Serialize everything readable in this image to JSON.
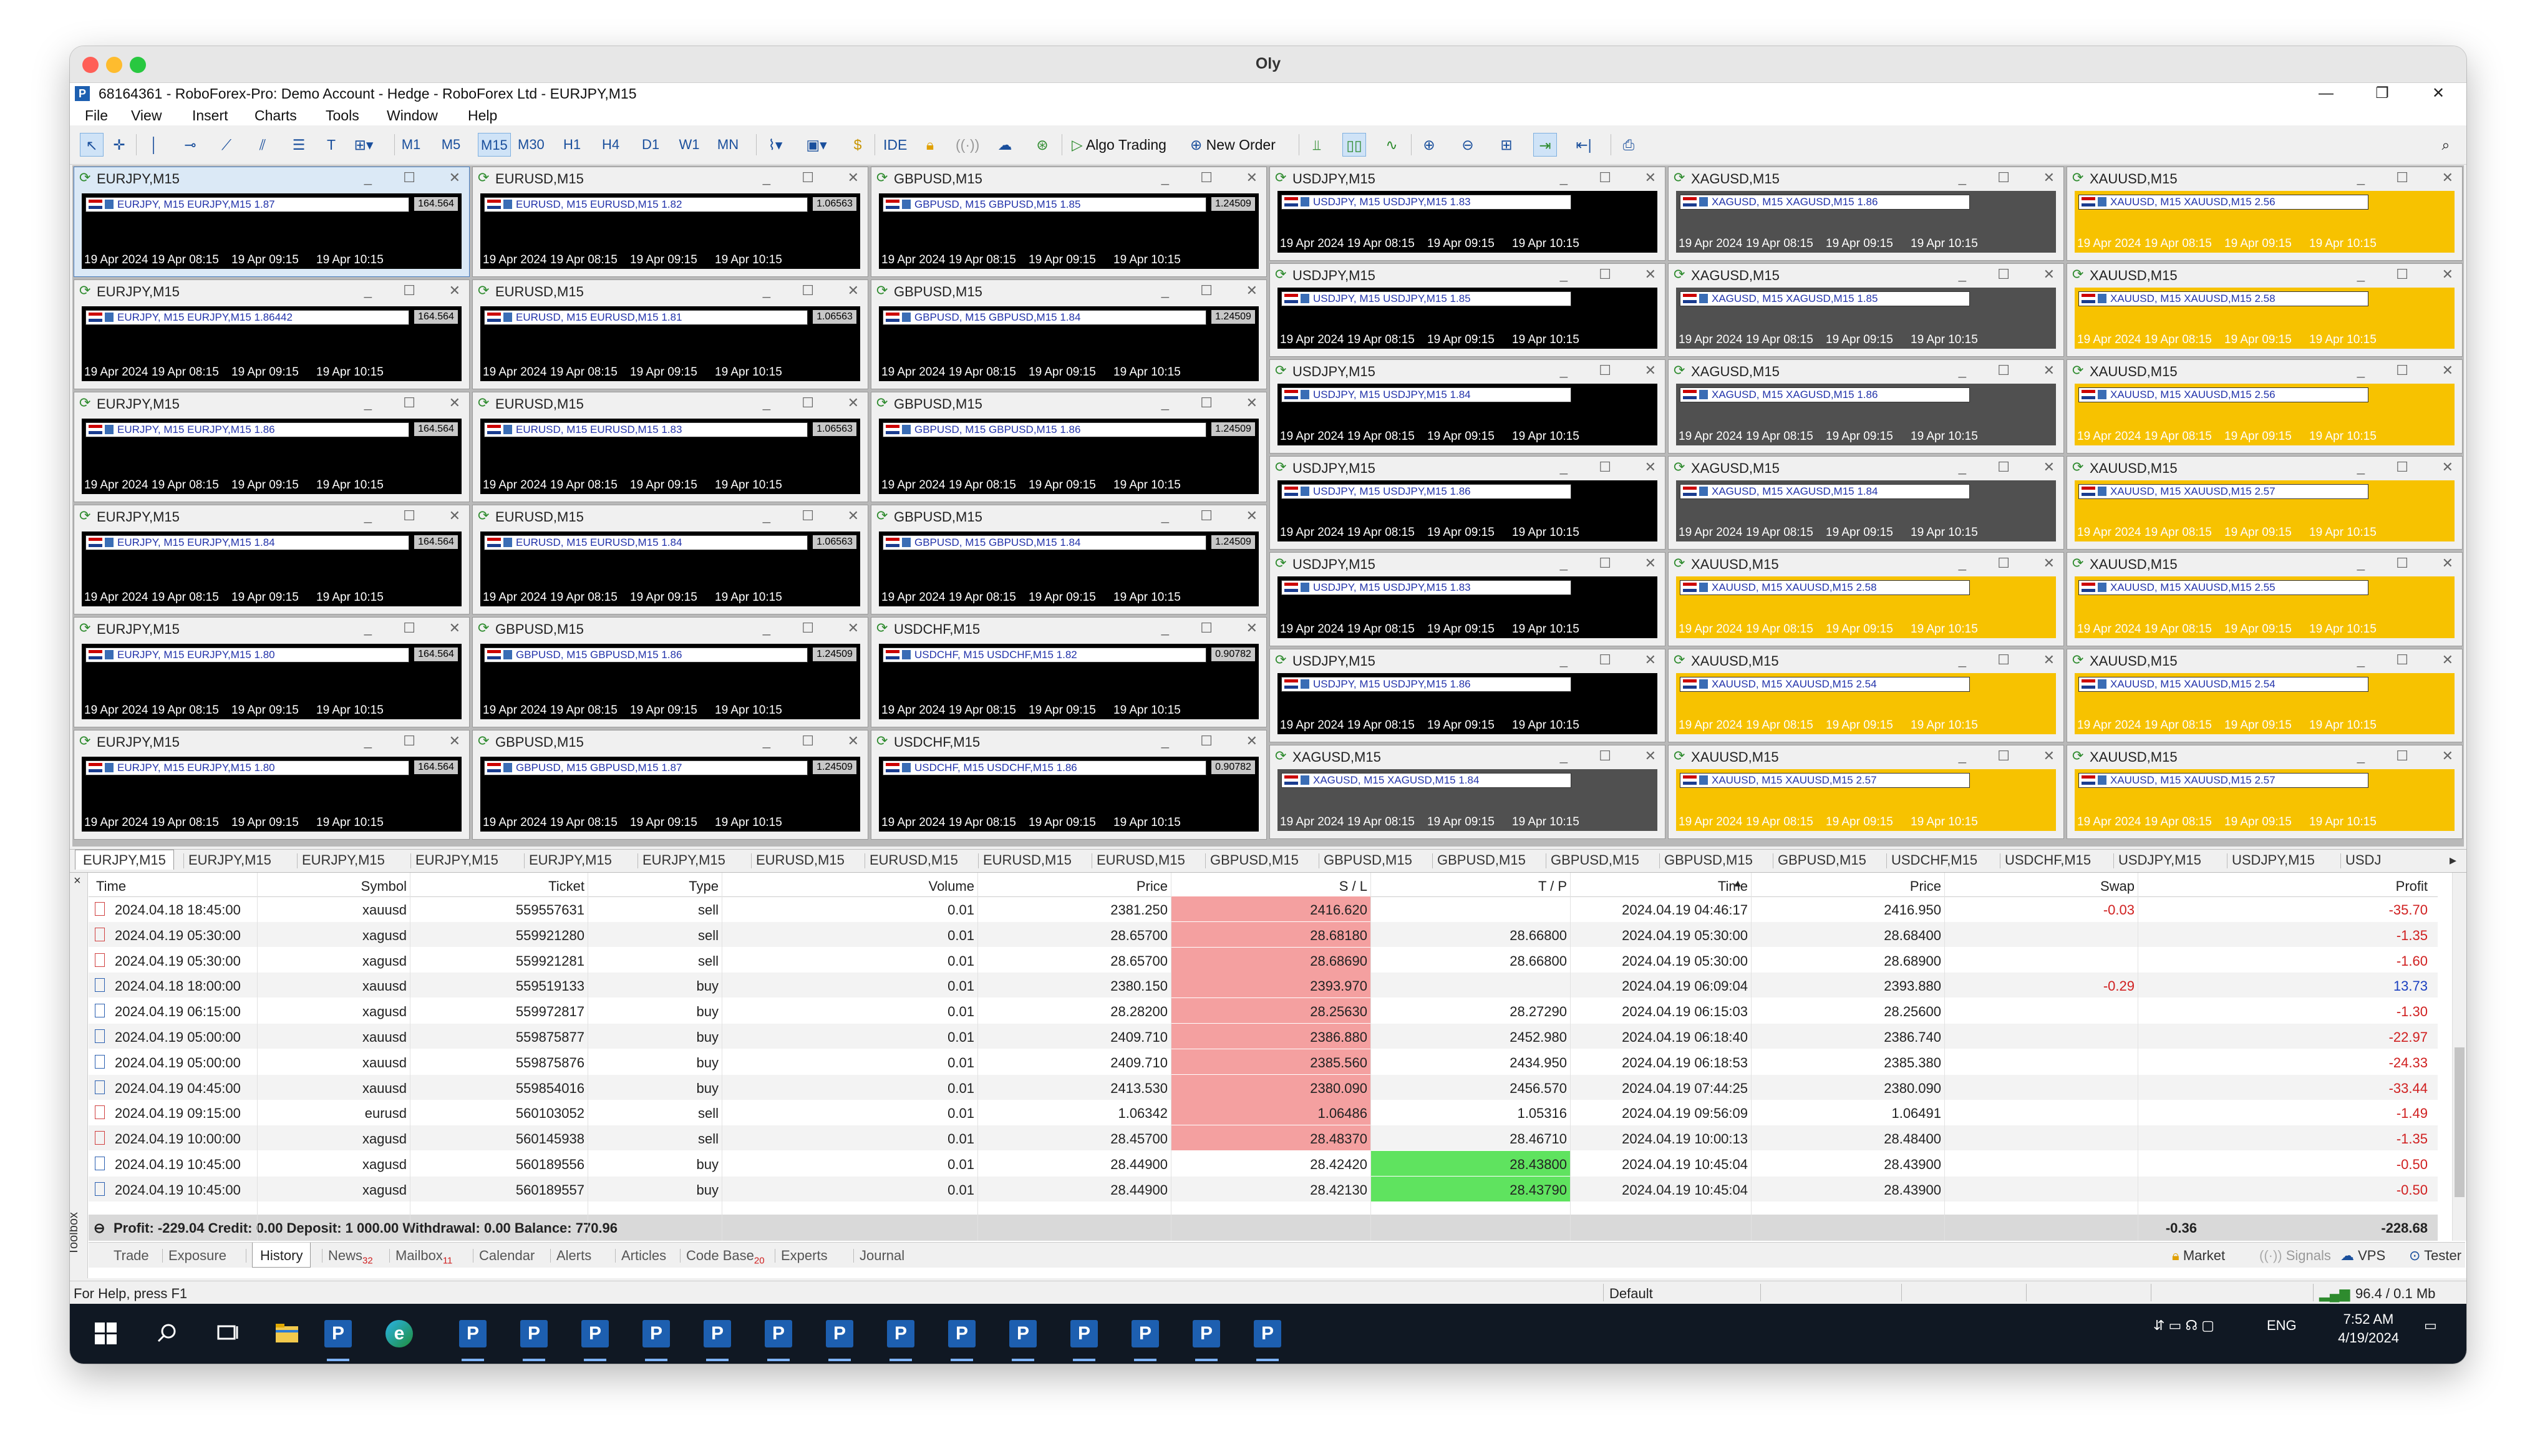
{
  "mac_window": {
    "title": "Oly"
  },
  "app": {
    "title": "68164361 - RoboForex-Pro: Demo Account - Hedge - RoboForex Ltd - EURJPY,M15",
    "app_icon": "mt5-icon",
    "window_controls": {
      "minimize": "—",
      "restore": "❐",
      "close": "✕"
    }
  },
  "menu": [
    "File",
    "View",
    "Insert",
    "Charts",
    "Tools",
    "Window",
    "Help"
  ],
  "toolbar": {
    "timeframes": [
      "M1",
      "M5",
      "M15",
      "M30",
      "H1",
      "H4",
      "D1",
      "W1",
      "MN"
    ],
    "active_timeframe": "M15",
    "ide_label": "IDE",
    "algo_trading_label": "Algo Trading",
    "new_order_label": "New Order"
  },
  "chart_axis_times": [
    "19 Apr 2024",
    "19 Apr 08:15",
    "19 Apr 09:15",
    "19 Apr 10:15"
  ],
  "charts": [
    {
      "symbol": "EURJPY,M15",
      "col": 0,
      "row": 0,
      "bg": "black",
      "strip": "EURJPY, M15 EURJPY,M15 1.87",
      "price": "164.564",
      "active": true
    },
    {
      "symbol": "EURJPY,M15",
      "col": 0,
      "row": 1,
      "bg": "black",
      "strip": "EURJPY, M15 EURJPY,M15 1.86442",
      "price": "164.564"
    },
    {
      "symbol": "EURJPY,M15",
      "col": 0,
      "row": 2,
      "bg": "black",
      "strip": "EURJPY, M15 EURJPY,M15 1.86",
      "price": "164.564"
    },
    {
      "symbol": "EURJPY,M15",
      "col": 0,
      "row": 3,
      "bg": "black",
      "strip": "EURJPY, M15 EURJPY,M15 1.84",
      "price": "164.564"
    },
    {
      "symbol": "EURJPY,M15",
      "col": 0,
      "row": 4,
      "bg": "black",
      "strip": "EURJPY, M15 EURJPY,M15 1.80",
      "price": "164.564"
    },
    {
      "symbol": "EURJPY,M15",
      "col": 0,
      "row": 5,
      "bg": "black",
      "strip": "EURJPY, M15 EURJPY,M15 1.80",
      "price": "164.564"
    },
    {
      "symbol": "EURUSD,M15",
      "col": 1,
      "row": 0,
      "bg": "black",
      "strip": "EURUSD, M15 EURUSD,M15 1.82",
      "price": "1.06563"
    },
    {
      "symbol": "EURUSD,M15",
      "col": 1,
      "row": 1,
      "bg": "black",
      "strip": "EURUSD, M15 EURUSD,M15 1.81",
      "price": "1.06563"
    },
    {
      "symbol": "EURUSD,M15",
      "col": 1,
      "row": 2,
      "bg": "black",
      "strip": "EURUSD, M15 EURUSD,M15 1.83",
      "price": "1.06563"
    },
    {
      "symbol": "EURUSD,M15",
      "col": 1,
      "row": 3,
      "bg": "black",
      "strip": "EURUSD, M15 EURUSD,M15 1.84",
      "price": "1.06563"
    },
    {
      "symbol": "GBPUSD,M15",
      "col": 1,
      "row": 4,
      "bg": "black",
      "strip": "GBPUSD, M15 GBPUSD,M15 1.86",
      "price": "1.24509"
    },
    {
      "symbol": "GBPUSD,M15",
      "col": 1,
      "row": 5,
      "bg": "black",
      "strip": "GBPUSD, M15 GBPUSD,M15 1.87",
      "price": "1.24509"
    },
    {
      "symbol": "GBPUSD,M15",
      "col": 2,
      "row": 0,
      "bg": "black",
      "strip": "GBPUSD, M15 GBPUSD,M15 1.85",
      "price": "1.24509"
    },
    {
      "symbol": "GBPUSD,M15",
      "col": 2,
      "row": 1,
      "bg": "black",
      "strip": "GBPUSD, M15 GBPUSD,M15 1.84",
      "price": "1.24509"
    },
    {
      "symbol": "GBPUSD,M15",
      "col": 2,
      "row": 2,
      "bg": "black",
      "strip": "GBPUSD, M15 GBPUSD,M15 1.86",
      "price": "1.24509"
    },
    {
      "symbol": "GBPUSD,M15",
      "col": 2,
      "row": 3,
      "bg": "black",
      "strip": "GBPUSD, M15 GBPUSD,M15 1.84",
      "price": "1.24509"
    },
    {
      "symbol": "USDCHF,M15",
      "col": 2,
      "row": 4,
      "bg": "black",
      "strip": "USDCHF, M15 USDCHF,M15 1.82",
      "price": "0.90782"
    },
    {
      "symbol": "USDCHF,M15",
      "col": 2,
      "row": 5,
      "bg": "black",
      "strip": "USDCHF, M15 USDCHF,M15 1.86",
      "price": "0.90782"
    },
    {
      "symbol": "USDJPY,M15",
      "col": 3,
      "row": 0,
      "bg": "black",
      "strip": "USDJPY, M15 USDJPY,M15 1.83"
    },
    {
      "symbol": "USDJPY,M15",
      "col": 3,
      "row": 1,
      "bg": "black",
      "strip": "USDJPY, M15 USDJPY,M15 1.85"
    },
    {
      "symbol": "USDJPY,M15",
      "col": 3,
      "row": 2,
      "bg": "black",
      "strip": "USDJPY, M15 USDJPY,M15 1.84"
    },
    {
      "symbol": "USDJPY,M15",
      "col": 3,
      "row": 3,
      "bg": "black",
      "strip": "USDJPY, M15 USDJPY,M15 1.86"
    },
    {
      "symbol": "USDJPY,M15",
      "col": 3,
      "row": 4,
      "bg": "black",
      "strip": "USDJPY, M15 USDJPY,M15 1.83"
    },
    {
      "symbol": "USDJPY,M15",
      "col": 3,
      "row": 5,
      "bg": "black",
      "strip": "USDJPY, M15 USDJPY,M15 1.86"
    },
    {
      "symbol": "XAGUSD,M15",
      "col": 3,
      "row": 6,
      "bg": "gray",
      "strip": "XAGUSD, M15 XAGUSD,M15 1.84"
    },
    {
      "symbol": "XAGUSD,M15",
      "col": 4,
      "row": 0,
      "bg": "gray",
      "strip": "XAGUSD, M15 XAGUSD,M15 1.86"
    },
    {
      "symbol": "XAGUSD,M15",
      "col": 4,
      "row": 1,
      "bg": "gray",
      "strip": "XAGUSD, M15 XAGUSD,M15 1.85"
    },
    {
      "symbol": "XAGUSD,M15",
      "col": 4,
      "row": 2,
      "bg": "gray",
      "strip": "XAGUSD, M15 XAGUSD,M15 1.86"
    },
    {
      "symbol": "XAGUSD,M15",
      "col": 4,
      "row": 3,
      "bg": "gray",
      "strip": "XAGUSD, M15 XAGUSD,M15 1.84"
    },
    {
      "symbol": "XAUUSD,M15",
      "col": 4,
      "row": 4,
      "bg": "yellow",
      "strip": "XAUUSD, M15 XAUUSD,M15 2.58"
    },
    {
      "symbol": "XAUUSD,M15",
      "col": 4,
      "row": 5,
      "bg": "yellow",
      "strip": "XAUUSD, M15 XAUUSD,M15 2.54"
    },
    {
      "symbol": "XAUUSD,M15",
      "col": 4,
      "row": 6,
      "bg": "yellow",
      "strip": "XAUUSD, M15 XAUUSD,M15 2.57"
    },
    {
      "symbol": "XAUUSD,M15",
      "col": 5,
      "row": 0,
      "bg": "yellow",
      "strip": "XAUUSD, M15 XAUUSD,M15 2.56"
    },
    {
      "symbol": "XAUUSD,M15",
      "col": 5,
      "row": 1,
      "bg": "yellow",
      "strip": "XAUUSD, M15 XAUUSD,M15 2.58"
    },
    {
      "symbol": "XAUUSD,M15",
      "col": 5,
      "row": 2,
      "bg": "yellow",
      "strip": "XAUUSD, M15 XAUUSD,M15 2.56"
    },
    {
      "symbol": "XAUUSD,M15",
      "col": 5,
      "row": 3,
      "bg": "yellow",
      "strip": "XAUUSD, M15 XAUUSD,M15 2.57"
    },
    {
      "symbol": "XAUUSD,M15",
      "col": 5,
      "row": 4,
      "bg": "yellow",
      "strip": "XAUUSD, M15 XAUUSD,M15 2.55"
    },
    {
      "symbol": "XAUUSD,M15",
      "col": 5,
      "row": 5,
      "bg": "yellow",
      "strip": "XAUUSD, M15 XAUUSD,M15 2.54"
    },
    {
      "symbol": "XAUUSD,M15",
      "col": 5,
      "row": 6,
      "bg": "yellow",
      "strip": "XAUUSD, M15 XAUUSD,M15 2.57"
    }
  ],
  "chart_tabs": [
    "EURJPY,M15",
    "EURJPY,M15",
    "EURJPY,M15",
    "EURJPY,M15",
    "EURJPY,M15",
    "EURJPY,M15",
    "EURUSD,M15",
    "EURUSD,M15",
    "EURUSD,M15",
    "EURUSD,M15",
    "GBPUSD,M15",
    "GBPUSD,M15",
    "GBPUSD,M15",
    "GBPUSD,M15",
    "GBPUSD,M15",
    "GBPUSD,M15",
    "USDCHF,M15",
    "USDCHF,M15",
    "USDJPY,M15",
    "USDJPY,M15",
    "USDJ"
  ],
  "history": {
    "columns": [
      "Time",
      "Symbol",
      "Ticket",
      "Type",
      "Volume",
      "Price",
      "S / L",
      "T / P",
      "Time",
      "Price",
      "Swap",
      "Profit"
    ],
    "rows": [
      {
        "time": "2024.04.18 18:45:00",
        "symbol": "xauusd",
        "ticket": "559557631",
        "type": "sell",
        "volume": "0.01",
        "price": "2381.250",
        "sl": "2416.620",
        "sl_hl": "red",
        "tp": "",
        "tp_hl": "",
        "close_time": "2024.04.19 04:46:17",
        "close_price": "2416.950",
        "swap": "-0.03",
        "profit": "-35.70"
      },
      {
        "time": "2024.04.19 05:30:00",
        "symbol": "xagusd",
        "ticket": "559921280",
        "type": "sell",
        "volume": "0.01",
        "price": "28.65700",
        "sl": "28.68180",
        "sl_hl": "red",
        "tp": "28.66800",
        "tp_hl": "",
        "close_time": "2024.04.19 05:30:00",
        "close_price": "28.68400",
        "swap": "",
        "profit": "-1.35"
      },
      {
        "time": "2024.04.19 05:30:00",
        "symbol": "xagusd",
        "ticket": "559921281",
        "type": "sell",
        "volume": "0.01",
        "price": "28.65700",
        "sl": "28.68690",
        "sl_hl": "red",
        "tp": "28.66800",
        "tp_hl": "",
        "close_time": "2024.04.19 05:30:00",
        "close_price": "28.68900",
        "swap": "",
        "profit": "-1.60"
      },
      {
        "time": "2024.04.18 18:00:00",
        "symbol": "xauusd",
        "ticket": "559519133",
        "type": "buy",
        "volume": "0.01",
        "price": "2380.150",
        "sl": "2393.970",
        "sl_hl": "red",
        "tp": "",
        "tp_hl": "",
        "close_time": "2024.04.19 06:09:04",
        "close_price": "2393.880",
        "swap": "-0.29",
        "profit": "13.73"
      },
      {
        "time": "2024.04.19 06:15:00",
        "symbol": "xagusd",
        "ticket": "559972817",
        "type": "buy",
        "volume": "0.01",
        "price": "28.28200",
        "sl": "28.25630",
        "sl_hl": "red",
        "tp": "28.27290",
        "tp_hl": "",
        "close_time": "2024.04.19 06:15:03",
        "close_price": "28.25600",
        "swap": "",
        "profit": "-1.30"
      },
      {
        "time": "2024.04.19 05:00:00",
        "symbol": "xauusd",
        "ticket": "559875877",
        "type": "buy",
        "volume": "0.01",
        "price": "2409.710",
        "sl": "2386.880",
        "sl_hl": "red",
        "tp": "2452.980",
        "tp_hl": "",
        "close_time": "2024.04.19 06:18:40",
        "close_price": "2386.740",
        "swap": "",
        "profit": "-22.97"
      },
      {
        "time": "2024.04.19 05:00:00",
        "symbol": "xauusd",
        "ticket": "559875876",
        "type": "buy",
        "volume": "0.01",
        "price": "2409.710",
        "sl": "2385.560",
        "sl_hl": "red",
        "tp": "2434.950",
        "tp_hl": "",
        "close_time": "2024.04.19 06:18:53",
        "close_price": "2385.380",
        "swap": "",
        "profit": "-24.33"
      },
      {
        "time": "2024.04.19 04:45:00",
        "symbol": "xauusd",
        "ticket": "559854016",
        "type": "buy",
        "volume": "0.01",
        "price": "2413.530",
        "sl": "2380.090",
        "sl_hl": "red",
        "tp": "2456.570",
        "tp_hl": "",
        "close_time": "2024.04.19 07:44:25",
        "close_price": "2380.090",
        "swap": "",
        "profit": "-33.44"
      },
      {
        "time": "2024.04.19 09:15:00",
        "symbol": "eurusd",
        "ticket": "560103052",
        "type": "sell",
        "volume": "0.01",
        "price": "1.06342",
        "sl": "1.06486",
        "sl_hl": "red",
        "tp": "1.05316",
        "tp_hl": "",
        "close_time": "2024.04.19 09:56:09",
        "close_price": "1.06491",
        "swap": "",
        "profit": "-1.49"
      },
      {
        "time": "2024.04.19 10:00:00",
        "symbol": "xagusd",
        "ticket": "560145938",
        "type": "sell",
        "volume": "0.01",
        "price": "28.45700",
        "sl": "28.48370",
        "sl_hl": "red",
        "tp": "28.46710",
        "tp_hl": "",
        "close_time": "2024.04.19 10:00:13",
        "close_price": "28.48400",
        "swap": "",
        "profit": "-1.35"
      },
      {
        "time": "2024.04.19 10:45:00",
        "symbol": "xagusd",
        "ticket": "560189556",
        "type": "buy",
        "volume": "0.01",
        "price": "28.44900",
        "sl": "28.42420",
        "sl_hl": "",
        "tp": "28.43800",
        "tp_hl": "green",
        "close_time": "2024.04.19 10:45:04",
        "close_price": "28.43900",
        "swap": "",
        "profit": "-0.50"
      },
      {
        "time": "2024.04.19 10:45:00",
        "symbol": "xagusd",
        "ticket": "560189557",
        "type": "buy",
        "volume": "0.01",
        "price": "28.44900",
        "sl": "28.42130",
        "sl_hl": "",
        "tp": "28.43790",
        "tp_hl": "green",
        "close_time": "2024.04.19 10:45:04",
        "close_price": "28.43900",
        "swap": "",
        "profit": "-0.50"
      }
    ],
    "summary": {
      "text": "Profit: -229.04  Credit: 0.00  Deposit: 1 000.00  Withdrawal: 0.00  Balance: 770.96",
      "swap_total": "-0.36",
      "profit_total": "-228.68"
    }
  },
  "toolbox_label": "Toolbox",
  "bottom_tabs": [
    {
      "label": "Trade"
    },
    {
      "label": "Exposure"
    },
    {
      "label": "History",
      "active": true
    },
    {
      "label": "News",
      "badge": "32"
    },
    {
      "label": "Mailbox",
      "badge": "11"
    },
    {
      "label": "Calendar"
    },
    {
      "label": "Alerts"
    },
    {
      "label": "Articles"
    },
    {
      "label": "Code Base",
      "badge": "20"
    },
    {
      "label": "Experts"
    },
    {
      "label": "Journal"
    }
  ],
  "bottom_right": [
    "Market",
    "Signals",
    "VPS",
    "Tester"
  ],
  "status": {
    "help": "For Help, press F1",
    "profile": "Default",
    "traffic": "96.4 / 0.1 Mb"
  },
  "taskbar": {
    "lang": "ENG",
    "time": "7:52 AM",
    "date": "4/19/2024"
  },
  "colors": {
    "sl_red": "#f4a0a0",
    "tp_green": "#5fe35f",
    "chart_black": "#000000",
    "chart_gray": "#505050",
    "chart_yellow": "#f7c200",
    "accent": "#1d5fb0",
    "taskbar": "#101823"
  }
}
